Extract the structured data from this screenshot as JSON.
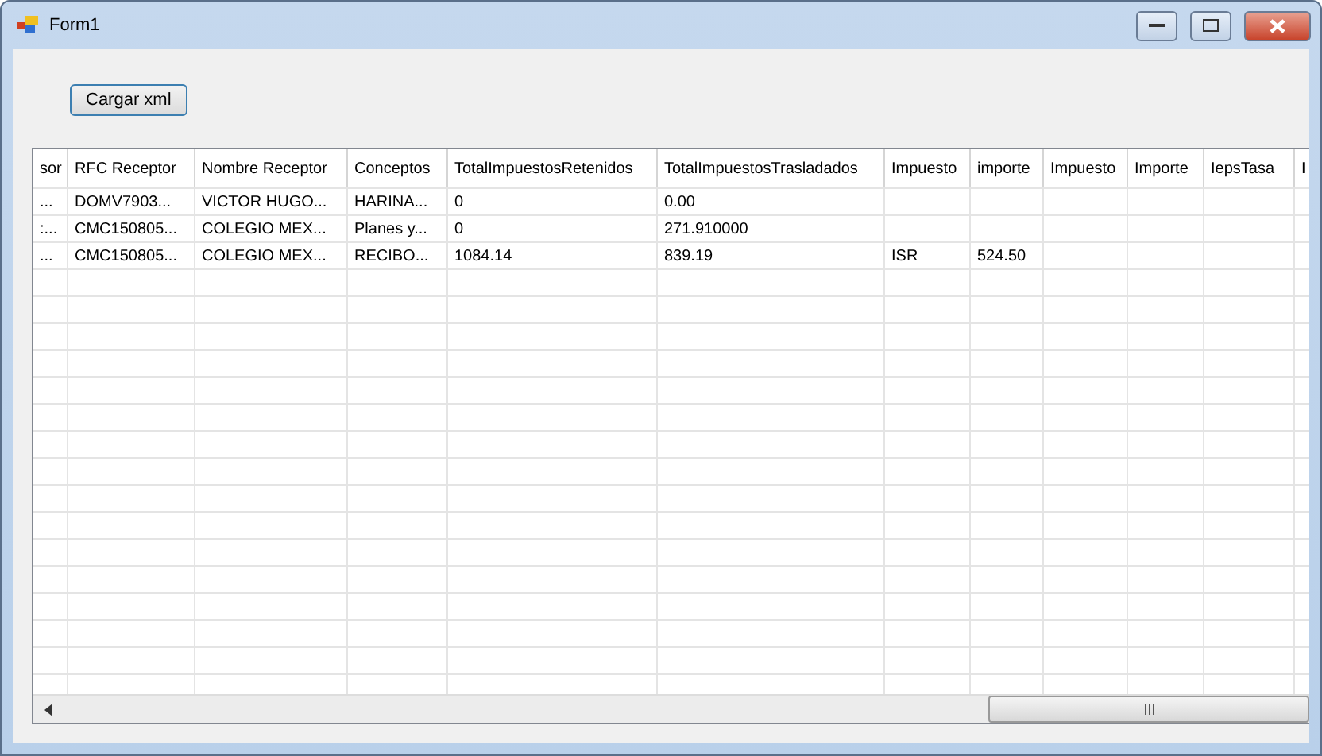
{
  "window": {
    "title": "Form1"
  },
  "buttons": [
    {
      "label": "Cargar xml"
    }
  ],
  "table": {
    "columns": [
      "sor",
      "RFC Receptor",
      "Nombre Receptor",
      "Conceptos",
      "TotalImpuestosRetenidos",
      "TotalImpuestosTrasladados",
      "Impuesto",
      "importe",
      "Impuesto",
      "Importe",
      "IepsTasa",
      "I"
    ],
    "rows": [
      [
        "...",
        "DOMV7903...",
        "VICTOR HUGO...",
        "HARINA...",
        "0",
        "0.00",
        "",
        "",
        "",
        "",
        "",
        ""
      ],
      [
        ":...",
        "CMC150805...",
        "COLEGIO MEX...",
        "Planes y...",
        "0",
        "271.910000",
        "",
        "",
        "",
        "",
        "",
        ""
      ],
      [
        "...",
        "CMC150805...",
        "COLEGIO MEX...",
        "RECIBO...",
        "1084.14",
        "839.19",
        "ISR",
        "524.50",
        "",
        "",
        "",
        ""
      ]
    ]
  }
}
